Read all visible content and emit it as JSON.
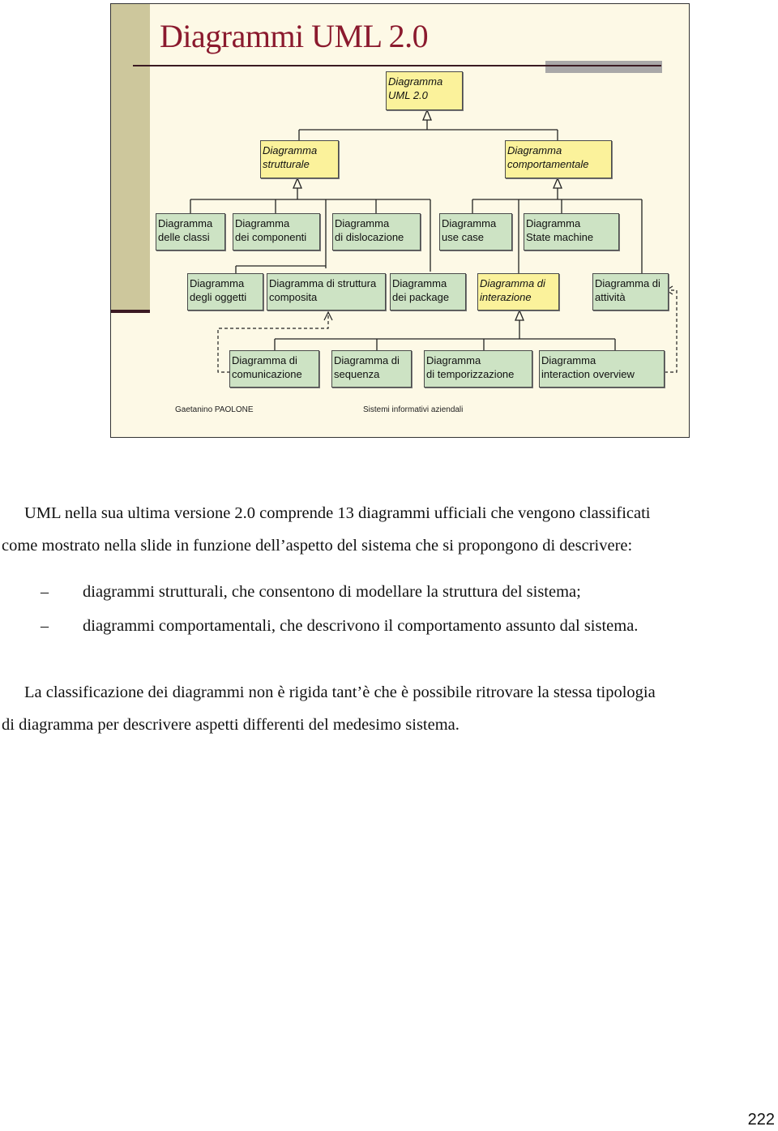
{
  "slide": {
    "title": "Diagrammi UML 2.0",
    "footer_author": "Gaetanino PAOLONE",
    "footer_course": "Sistemi informativi aziendali",
    "colors": {
      "title": "#8b1a2e",
      "abstract_box": "#fbf29b",
      "concrete_box": "#cde3c4",
      "background": "#fdf9e6",
      "sidebar": "#cdc79c"
    },
    "diagram": {
      "root": {
        "label": "Diagramma\nUML 2.0",
        "abstract": true
      },
      "structural": {
        "label": "Diagramma\nstrutturale",
        "abstract": true
      },
      "behavioral": {
        "label": "Diagramma\ncomportamentale",
        "abstract": true
      },
      "classi": {
        "label": "Diagramma\ndelle classi"
      },
      "componenti": {
        "label": "Diagramma\ndei componenti"
      },
      "dislocazione": {
        "label": "Diagramma\ndi dislocazione"
      },
      "use_case": {
        "label": "Diagramma\nuse case"
      },
      "state_machine": {
        "label": "Diagramma\nState machine"
      },
      "oggetti": {
        "label": "Diagramma\ndegli oggetti"
      },
      "struttura_composita": {
        "label": "Diagramma di struttura\ncomposita"
      },
      "package": {
        "label": "Diagramma\ndei package"
      },
      "interazione": {
        "label": "Diagramma di\ninterazione",
        "abstract": true
      },
      "attivita": {
        "label": "Diagramma di\nattività"
      },
      "comunicazione": {
        "label": "Diagramma di\ncomunicazione"
      },
      "sequenza": {
        "label": "Diagramma di\nsequenza"
      },
      "temporizzazione": {
        "label": "Diagramma\ndi temporizzazione"
      },
      "interaction_overview": {
        "label": "Diagramma\ninteraction overview"
      }
    }
  },
  "body": {
    "para1_line1": "UML nella sua ultima versione 2.0 comprende 13 diagrammi ufficiali che vengono classificati",
    "para1_line2": "come mostrato nella slide in funzione dell’aspetto del sistema che si propongono di descrivere:",
    "bullet_marker": "–",
    "bullets": [
      "diagrammi strutturali, che consentono di modellare la struttura del sistema;",
      "diagrammi comportamentali, che descrivono il comportamento assunto dal sistema."
    ],
    "para2_line1": "La classificazione dei diagrammi non è rigida tant’è che è possibile ritrovare la stessa tipologia",
    "para2_line2": "di diagramma per descrivere aspetti differenti del medesimo sistema."
  },
  "page_number": "222"
}
